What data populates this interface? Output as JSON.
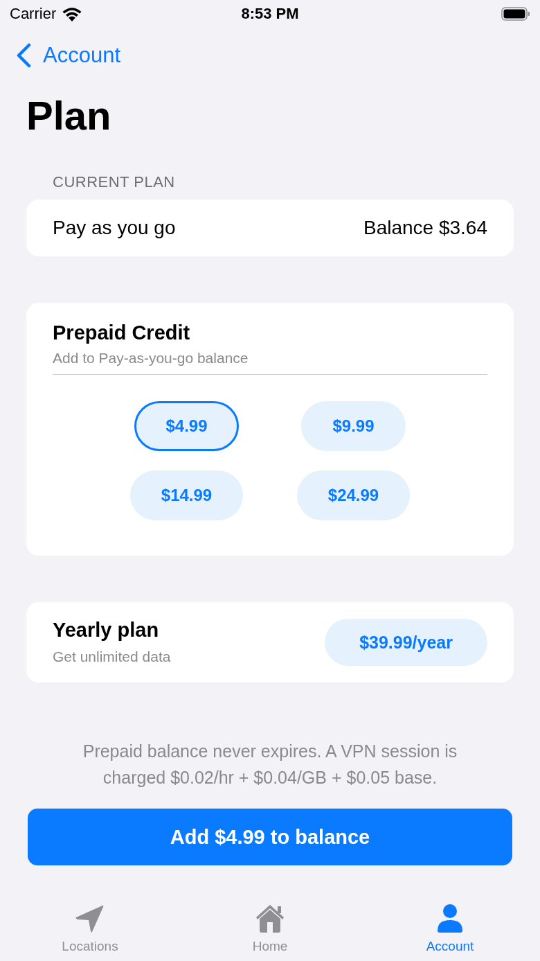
{
  "status_bar": {
    "carrier": "Carrier",
    "time": "8:53 PM"
  },
  "nav": {
    "back_label": "Account"
  },
  "title": "Plan",
  "current_plan": {
    "header": "CURRENT PLAN",
    "name": "Pay as you go",
    "balance": "Balance $3.64"
  },
  "prepaid_credit": {
    "title": "Prepaid Credit",
    "subtitle": "Add to Pay-as-you-go balance",
    "options": [
      {
        "label": "$4.99",
        "selected": true
      },
      {
        "label": "$9.99",
        "selected": false
      },
      {
        "label": "$14.99",
        "selected": false
      },
      {
        "label": "$24.99",
        "selected": false
      }
    ]
  },
  "yearly_plan": {
    "title": "Yearly plan",
    "subtitle": "Get unlimited data",
    "price_button": "$39.99/year"
  },
  "footnote": "Prepaid balance never expires. A VPN session is charged $0.02/hr + $0.04/GB + $0.05 base.",
  "primary_button": "Add $4.99 to balance",
  "tab_bar": [
    {
      "label": "Locations",
      "selected": false
    },
    {
      "label": "Home",
      "selected": false
    },
    {
      "label": "Account",
      "selected": true
    }
  ]
}
